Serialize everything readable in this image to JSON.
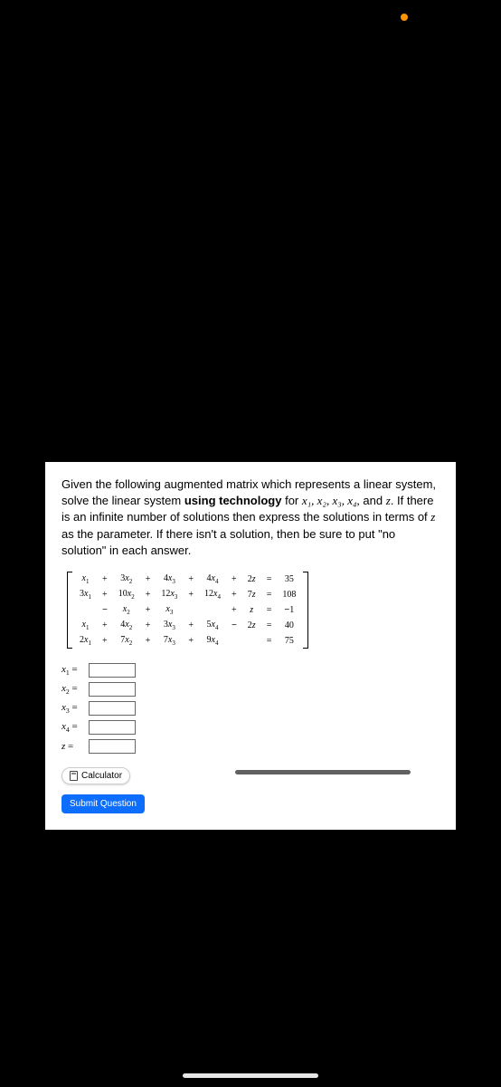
{
  "status": {
    "orange_dot": true
  },
  "problem": {
    "text_before_vars": "Given the following augmented matrix which represents a linear system, solve the linear system ",
    "bold1": "using technology",
    "text_mid1": " for ",
    "vars_inline": "x₁, x₂, x₃, x₄,",
    "text_mid2": " and ",
    "var_z": "z",
    "text_mid3": ". If there is an infinite number of solutions then express the solutions in terms of ",
    "var_z2": "z",
    "text_mid4": " as the parameter. If there isn't a solution, then be sure to put \"no solution\" in each answer."
  },
  "matrix": {
    "rows": [
      [
        "x₁",
        "+",
        "3x₂",
        "+",
        "4x₃",
        "+",
        "4x₄",
        "+",
        "2z",
        "=",
        "35"
      ],
      [
        "3x₁",
        "+",
        "10x₂",
        "+",
        "12x₃",
        "+",
        "12x₄",
        "+",
        "7z",
        "=",
        "108"
      ],
      [
        "",
        "−",
        "x₂",
        "+",
        "x₃",
        "",
        "",
        "+",
        "z",
        "=",
        "−1"
      ],
      [
        "x₁",
        "+",
        "4x₂",
        "+",
        "3x₃",
        "+",
        "5x₄",
        "−",
        "2z",
        "=",
        "40"
      ],
      [
        "2x₁",
        "+",
        "7x₂",
        "+",
        "7x₃",
        "+",
        "9x₄",
        "",
        "",
        "=",
        "75"
      ]
    ]
  },
  "answers": {
    "labels": [
      "x₁ =",
      "x₂ =",
      "x₃ =",
      "x₄ =",
      "z ="
    ],
    "values": [
      "",
      "",
      "",
      "",
      ""
    ]
  },
  "buttons": {
    "calculator": "Calculator",
    "submit": "Submit Question"
  }
}
